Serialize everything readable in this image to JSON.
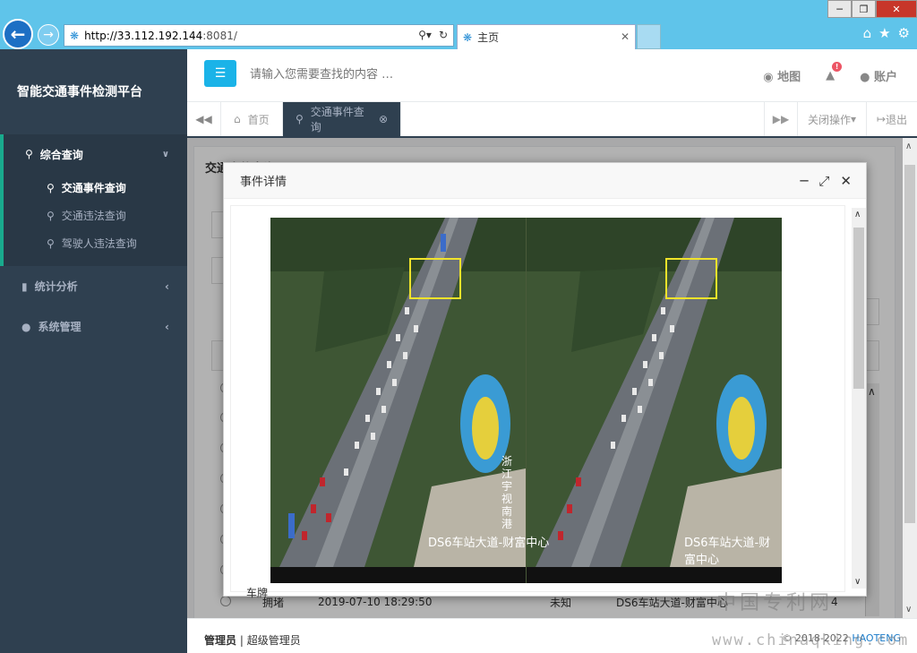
{
  "browser": {
    "url_host": "http://33.112.192.144",
    "url_rest": ":8081/",
    "tab_title": "主页"
  },
  "sidebar": {
    "brand": "智能交通事件检测平台",
    "groups": [
      {
        "label": "综合查询",
        "items": [
          {
            "label": "交通事件查询"
          },
          {
            "label": "交通违法查询"
          },
          {
            "label": "驾驶人违法查询"
          }
        ]
      }
    ],
    "items": [
      {
        "label": "统计分析"
      },
      {
        "label": "系统管理"
      }
    ]
  },
  "header": {
    "search_placeholder": "请输入您需要查找的内容 …",
    "map_label": "地图",
    "notification_count": "!",
    "account_label": "账户"
  },
  "tabbar": {
    "home": "首页",
    "active": "交通事件查询",
    "close_ops": "关闭操作",
    "logout": "退出"
  },
  "background": {
    "panel_title": "交通事件查询",
    "row": {
      "type": "拥堵",
      "time": "2019-07-10 18:29:50",
      "status": "未知",
      "location": "DS6车站大道-财富中心",
      "count": "4"
    }
  },
  "modal": {
    "title": "事件详情",
    "plate_label": "车牌",
    "image": {
      "left_caption": "DS6车站大道-财富中心",
      "right_caption": "DS6车站大道-财富中心",
      "side_text": "浙江宇视 南港"
    }
  },
  "footer": {
    "role": "管理员",
    "user": "超级管理员",
    "copyright": "© 2018-2022",
    "company": "HAOTENG"
  },
  "watermark": {
    "cn": "中国专利网",
    "url": "www.chinaqking.com"
  }
}
